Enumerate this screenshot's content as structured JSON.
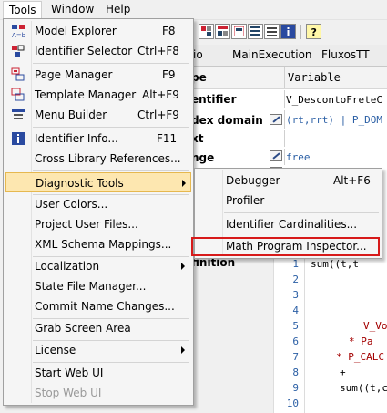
{
  "menubar": {
    "items": [
      "Tools",
      "Window",
      "Help"
    ]
  },
  "doc_tabs": [
    "io",
    "MainExecution",
    "FluxosTT"
  ],
  "attributes": {
    "header_left": "pe",
    "header_right": "Variable",
    "rows": [
      {
        "label": "entifier",
        "value": "V_DescontoFreteC"
      },
      {
        "label": "dex domain",
        "value": "(rt,rrt) | P_DOM"
      },
      {
        "label": "xt",
        "value": ""
      },
      {
        "label": "nge",
        "value": "free"
      },
      {
        "label": "finition",
        "value": ""
      }
    ]
  },
  "code": {
    "lines": [
      "1",
      "2",
      "3",
      "4",
      "5",
      "6",
      "7",
      "8",
      "9",
      "10"
    ],
    "snippets": [
      "sum((t,t",
      "V_Vo",
      "* Pa",
      "* P_CALC",
      "+",
      "sum((t,c"
    ]
  },
  "tools_menu": {
    "items": [
      {
        "label": "Model Explorer",
        "shortcut": "F8",
        "icon": "model-explorer-icon"
      },
      {
        "label": "Identifier Selector",
        "shortcut": "Ctrl+F8",
        "icon": "identifier-selector-icon"
      },
      {
        "label": "Page Manager",
        "shortcut": "F9",
        "icon": "page-manager-icon"
      },
      {
        "label": "Template Manager",
        "shortcut": "Alt+F9",
        "icon": "template-manager-icon"
      },
      {
        "label": "Menu Builder",
        "shortcut": "Ctrl+F9",
        "icon": "menu-builder-icon"
      },
      {
        "label": "Identifier Info...",
        "shortcut": "F11",
        "icon": "info-icon"
      },
      {
        "label": "Cross Library References...",
        "shortcut": ""
      },
      {
        "label": "Diagnostic Tools",
        "shortcut": "",
        "submenu": true,
        "highlighted": true
      },
      {
        "label": "User Colors...",
        "shortcut": ""
      },
      {
        "label": "Project User Files...",
        "shortcut": ""
      },
      {
        "label": "XML Schema Mappings...",
        "shortcut": ""
      },
      {
        "label": "Localization",
        "shortcut": "",
        "submenu": true
      },
      {
        "label": "State File Manager...",
        "shortcut": ""
      },
      {
        "label": "Commit Name Changes...",
        "shortcut": ""
      },
      {
        "label": "Grab Screen Area",
        "shortcut": ""
      },
      {
        "label": "License",
        "shortcut": "",
        "submenu": true
      },
      {
        "label": "Start Web UI",
        "shortcut": ""
      },
      {
        "label": "Stop Web UI",
        "shortcut": "",
        "disabled": true
      }
    ]
  },
  "diagnostic_submenu": {
    "items": [
      {
        "label": "Debugger",
        "shortcut": "Alt+F6"
      },
      {
        "label": "Profiler",
        "shortcut": ""
      },
      {
        "label": "Identifier Cardinalities...",
        "shortcut": ""
      },
      {
        "label": "Math Program Inspector...",
        "shortcut": "",
        "annotated": true
      }
    ]
  },
  "colors": {
    "highlight_bg": "#fde7b0",
    "highlight_border": "#e6b84f",
    "annotation_red": "#d71a1a",
    "code_blue": "#2b5fa5",
    "code_red": "#a40000"
  }
}
